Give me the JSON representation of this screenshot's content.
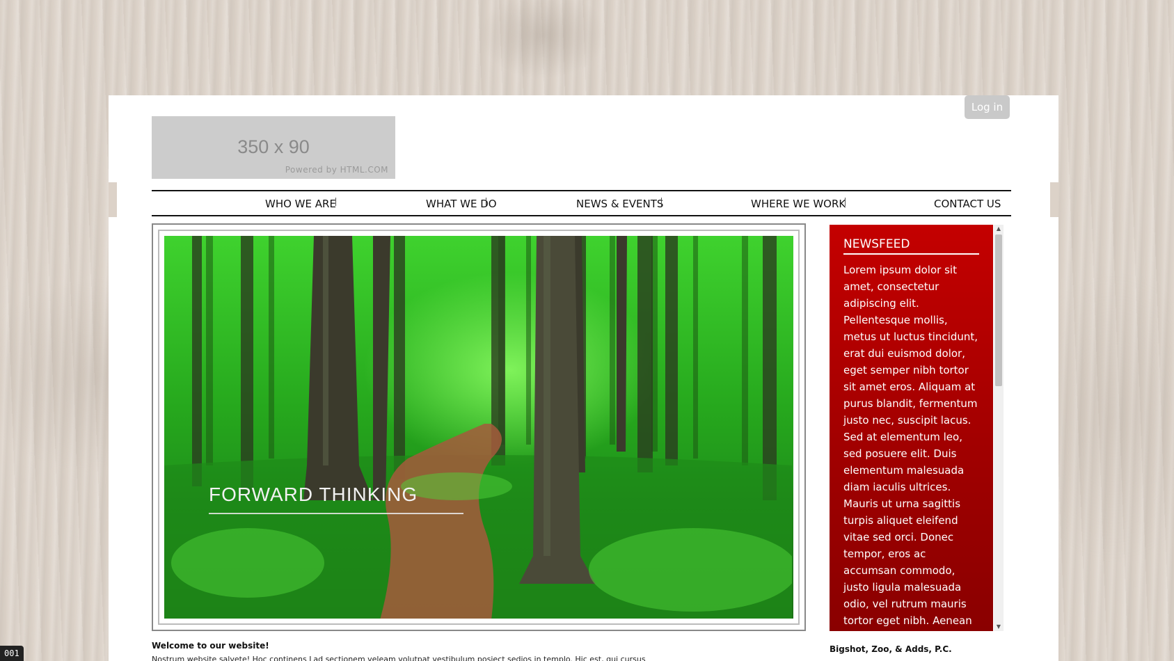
{
  "header": {
    "login_label": "Log in",
    "logo_size": "350 x 90",
    "logo_powered": "Powered by HTML.COM"
  },
  "nav": {
    "items": [
      "WHO WE ARE",
      "WHAT WE DO",
      "NEWS & EVENTS",
      "WHERE WE WORK",
      "CONTACT US"
    ]
  },
  "hero": {
    "caption": "FORWARD THINKING"
  },
  "newsfeed": {
    "title": "NEWSFEED",
    "text": "Lorem ipsum dolor sit amet, consectetur adipiscing elit. Pellentesque mollis, metus ut luctus tincidunt, erat dui euismod dolor, eget semper nibh tortor sit amet eros. Aliquam at purus blandit, fermentum justo nec, suscipit lacus. Sed at elementum leo, sed posuere elit. Duis elementum malesuada diam iaculis ultrices. Mauris ut urna sagittis turpis aliquet eleifend vitae sed orci. Donec tempor, eros ac accumsan commodo, justo ligula malesuada odio, vel rutrum mauris tortor eget nibh. Aenean tempor"
  },
  "content": {
    "welcome": "Welcome to our website!",
    "body": "Nostrum website salvete! Hoc continens Lad sectionem veleam volutpat vestibulum posiect sedios in templo. Hic est, qui cursus",
    "firm_name": "Bigshot, Zoo, & Adds, P.C."
  },
  "badge": {
    "text": "001"
  },
  "colors": {
    "newsfeed_top": "#c40000",
    "newsfeed_bottom": "#8a0000",
    "login_bg": "#c9c9c9",
    "background": "#dcd2c8"
  }
}
